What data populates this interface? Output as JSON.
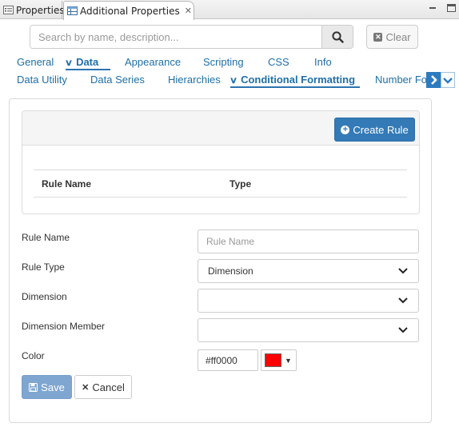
{
  "view_tabs": {
    "properties_label": "Properties",
    "additional_label": "Additional Properties",
    "close_glyph": "✕"
  },
  "search": {
    "placeholder": "Search by name, description...",
    "value": "",
    "clear_label": "Clear"
  },
  "tabs_row1": [
    {
      "label": "General"
    },
    {
      "label": "Data",
      "selected": true
    },
    {
      "label": "Appearance"
    },
    {
      "label": "Scripting"
    },
    {
      "label": "CSS"
    },
    {
      "label": "Info"
    }
  ],
  "tabs_row2": [
    {
      "label": "Data Utility"
    },
    {
      "label": "Data Series"
    },
    {
      "label": "Hierarchies"
    },
    {
      "label": "Conditional Formatting",
      "selected": true
    },
    {
      "label": "Number For"
    }
  ],
  "rules": {
    "create_label": "Create Rule",
    "col_name": "Rule Name",
    "col_type": "Type"
  },
  "form": {
    "rule_name_label": "Rule Name",
    "rule_name_placeholder": "Rule Name",
    "rule_name_value": "",
    "rule_type_label": "Rule Type",
    "rule_type_value": "Dimension",
    "dimension_label": "Dimension",
    "dimension_value": "",
    "dimension_member_label": "Dimension Member",
    "dimension_member_value": "",
    "color_label": "Color",
    "color_value": "#ff0000",
    "color_text": "#ff0000",
    "save_label": "Save",
    "cancel_label": "Cancel"
  },
  "colors": {
    "accent": "#337ab7",
    "link": "#1f6fa8",
    "swatch": "#ff0000",
    "save_disabled": "#7fa6d0"
  }
}
